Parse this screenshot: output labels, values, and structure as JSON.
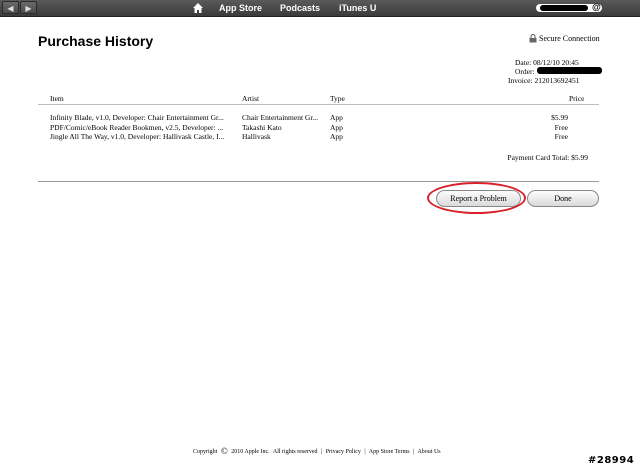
{
  "topbar": {
    "back_glyph": "◀",
    "forward_glyph": "▶",
    "home_icon": "home-icon",
    "links": [
      "App Store",
      "Podcasts",
      "iTunes U"
    ],
    "account_suffix": "@"
  },
  "page": {
    "title": "Purchase History",
    "secure_label": "Secure Connection"
  },
  "meta": {
    "date_label": "Date:",
    "date_value": "08/12/10 20:45",
    "order_label": "Order:",
    "invoice_label": "Invoice:",
    "invoice_value": "212013692451"
  },
  "table": {
    "headers": [
      "Item",
      "Artist",
      "Type",
      "Price"
    ],
    "rows": [
      {
        "item": "Infinity Blade, v1.0, Developer: Chair Entertainment Gr...",
        "artist": "Chair Entertainment Gr...",
        "type": "App",
        "price": "$5.99"
      },
      {
        "item": "PDF/Comic/eBook Reader Bookmen, v2.5, Developer: ...",
        "artist": "Takashi Kato",
        "type": "App",
        "price": "Free"
      },
      {
        "item": "Jingle All The Way, v1.0, Developer: Hallivask Castle, I...",
        "artist": "Hallivask",
        "type": "App",
        "price": "Free"
      }
    ],
    "total_label": "Payment Card Total:",
    "total_value": "$5.99"
  },
  "buttons": {
    "report": "Report a Problem",
    "done": "Done"
  },
  "footer": {
    "copyright": "Copyright",
    "symbol": "©",
    "company": "2010 Apple Inc.",
    "rights": "All rights reserved",
    "sep": "|",
    "privacy": "Privacy Policy",
    "terms": "App Store Terms",
    "about": "About Us"
  },
  "watermark": "#28994",
  "colors": {
    "highlight": "#d8202a",
    "topbar": "#4a4a4a"
  }
}
